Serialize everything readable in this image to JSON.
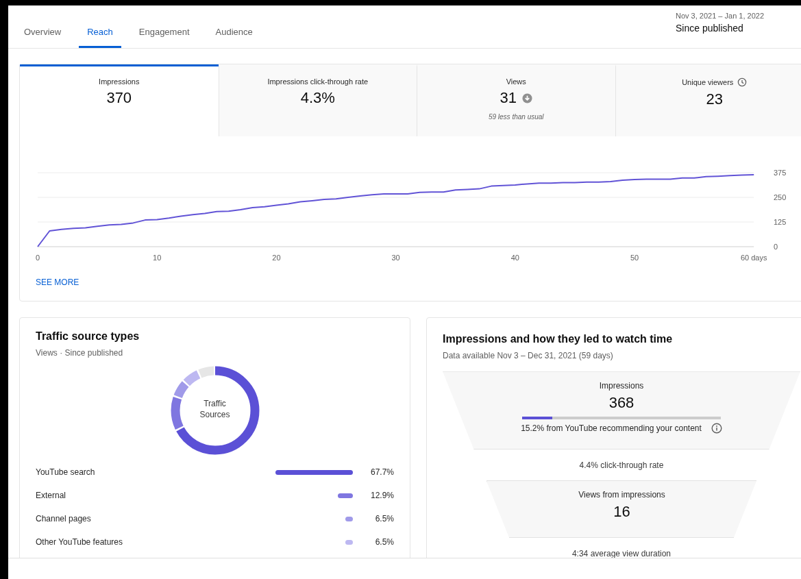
{
  "tabs": [
    {
      "label": "Overview",
      "selected": false
    },
    {
      "label": "Reach",
      "selected": true
    },
    {
      "label": "Engagement",
      "selected": false
    },
    {
      "label": "Audience",
      "selected": false
    }
  ],
  "date_range": {
    "range": "Nov 3, 2021 – Jan 1, 2022",
    "label": "Since published"
  },
  "metrics": [
    {
      "label": "Impressions",
      "value": "370",
      "selected": true
    },
    {
      "label": "Impressions click-through rate",
      "value": "4.3%",
      "selected": false
    },
    {
      "label": "Views",
      "value": "31",
      "selected": false,
      "trending_down": true,
      "note": "59 less than usual"
    },
    {
      "label": "Unique viewers",
      "value": "23",
      "selected": false,
      "clock": true
    }
  ],
  "chart_data": {
    "type": "line",
    "x": [
      0,
      1,
      2,
      3,
      4,
      5,
      6,
      7,
      8,
      9,
      10,
      11,
      12,
      13,
      14,
      15,
      16,
      17,
      18,
      19,
      20,
      21,
      22,
      23,
      24,
      25,
      26,
      27,
      28,
      29,
      30,
      31,
      32,
      33,
      34,
      35,
      36,
      37,
      38,
      39,
      40,
      41,
      42,
      43,
      44,
      45,
      46,
      47,
      48,
      49,
      50,
      51,
      52,
      53,
      54,
      55,
      56,
      57,
      58,
      59,
      60
    ],
    "xlim": [
      0,
      60
    ],
    "ylim": [
      0,
      375
    ],
    "xticks": [
      {
        "value": 0,
        "label": "0"
      },
      {
        "value": 10,
        "label": "10"
      },
      {
        "value": 20,
        "label": "20"
      },
      {
        "value": 30,
        "label": "30"
      },
      {
        "value": 40,
        "label": "40"
      },
      {
        "value": 50,
        "label": "50"
      },
      {
        "value": 60,
        "label": "60 days"
      }
    ],
    "yticks": [
      {
        "value": 0,
        "label": "0"
      },
      {
        "value": 125,
        "label": "125"
      },
      {
        "value": 250,
        "label": "250"
      },
      {
        "value": 375,
        "label": "375"
      }
    ],
    "series": [
      {
        "color": "#6153d6",
        "values": [
          0,
          80,
          88,
          93,
          95,
          103,
          110,
          113,
          120,
          135,
          137,
          145,
          155,
          162,
          168,
          178,
          180,
          188,
          198,
          202,
          210,
          217,
          227,
          233,
          240,
          242,
          250,
          257,
          263,
          267,
          267,
          267,
          275,
          277,
          277,
          287,
          290,
          293,
          307,
          310,
          313,
          318,
          322,
          322,
          325,
          325,
          327,
          327,
          330,
          337,
          340,
          342,
          342,
          342,
          348,
          348,
          355,
          357,
          360,
          363,
          365
        ]
      }
    ]
  },
  "see_more": "SEE MORE",
  "traffic": {
    "title": "Traffic source types",
    "subtitle": "Views · Since published",
    "center_label": "Traffic Sources",
    "sources": [
      {
        "name": "YouTube search",
        "share": "67.7%",
        "color": "#5b50d6"
      },
      {
        "name": "External",
        "share": "12.9%",
        "color": "#7f76e0"
      },
      {
        "name": "Channel pages",
        "share": "6.5%",
        "color": "#a09ae9"
      },
      {
        "name": "Other YouTube features",
        "share": "6.5%",
        "color": "#bdb8f1"
      }
    ]
  },
  "funnel_card": {
    "title": "Impressions and how they led to watch time",
    "subtitle": "Data available Nov 3 – Dec 31, 2021 (59 days)",
    "steps": [
      {
        "kind": "metric",
        "label": "Impressions",
        "value": "368",
        "level": 0.152,
        "note": "15.2% from YouTube recommending your content"
      },
      {
        "kind": "rate",
        "text": "4.4% click-through rate"
      },
      {
        "kind": "metric",
        "label": "Views from impressions",
        "value": "16"
      },
      {
        "kind": "rate",
        "text": "4:34 average view duration"
      }
    ]
  }
}
